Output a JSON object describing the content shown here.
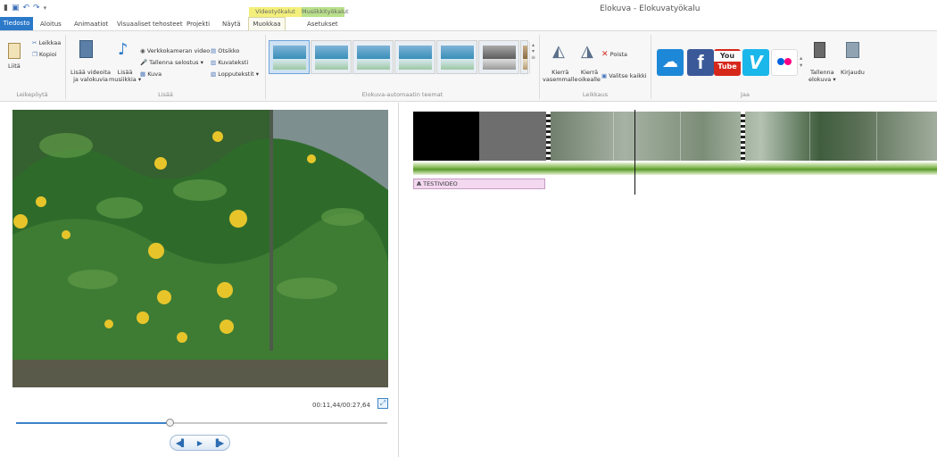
{
  "window": {
    "title": "Elokuva - Elokuvatyökalu",
    "context_video": "Videotyökalut",
    "context_music": "Musiikkityökalut"
  },
  "tabs": [
    {
      "label": "Tiedosto"
    },
    {
      "label": "Aloitus"
    },
    {
      "label": "Animaatiot"
    },
    {
      "label": "Visuaaliset tehosteet"
    },
    {
      "label": "Projekti"
    },
    {
      "label": "Näytä"
    },
    {
      "label": "Muokkaa"
    },
    {
      "label": "Asetukset"
    }
  ],
  "ribbon": {
    "clipboard": {
      "paste": "Liitä",
      "cut": "Leikkaa",
      "copy": "Kopioi",
      "group": "Leikepöytä"
    },
    "add": {
      "add_videos_line1": "Lisää videoita",
      "add_videos_line2": "ja valokuvia",
      "add_music_line1": "Lisää",
      "add_music_line2": "musiikkia ▾",
      "webcam": "Verkkokameran video",
      "narration": "Tallenna selostus ▾",
      "snapshot": "Kuva",
      "title": "Otsikko",
      "caption": "Kuvateksti",
      "credits": "Lopputekstit ▾",
      "group": "Lisää"
    },
    "themes": {
      "group": "Elokuva-automaatin teemat"
    },
    "editing": {
      "rotate_left_line1": "Kierrä",
      "rotate_left_line2": "vasemmalle",
      "rotate_right_line1": "Kierrä",
      "rotate_right_line2": "oikealle",
      "remove": "Poista",
      "select_all": "Valitse kaikki",
      "group": "Leikkaus"
    },
    "share": {
      "save_line1": "Tallenna",
      "save_line2": "elokuva ▾",
      "signin": "Kirjaudu",
      "group": "Jaa",
      "youtube_line1": "You",
      "youtube_line2": "Tube",
      "vimeo": "V"
    }
  },
  "preview": {
    "timecode": "00:11,44/00:27,64",
    "progress": 0.414
  },
  "timeline": {
    "caption_text": "TESTIVIDEO"
  },
  "colors": {
    "accent": "#2b79c9",
    "context_video": "#f3ef7a",
    "context_music": "#b9e08a",
    "onedrive": "#1e88d8",
    "facebook": "#3b5998",
    "youtube": "#d6271b",
    "vimeo": "#1ab7ea",
    "flickr_blue": "#0063dc",
    "flickr_pink": "#ff0084"
  }
}
